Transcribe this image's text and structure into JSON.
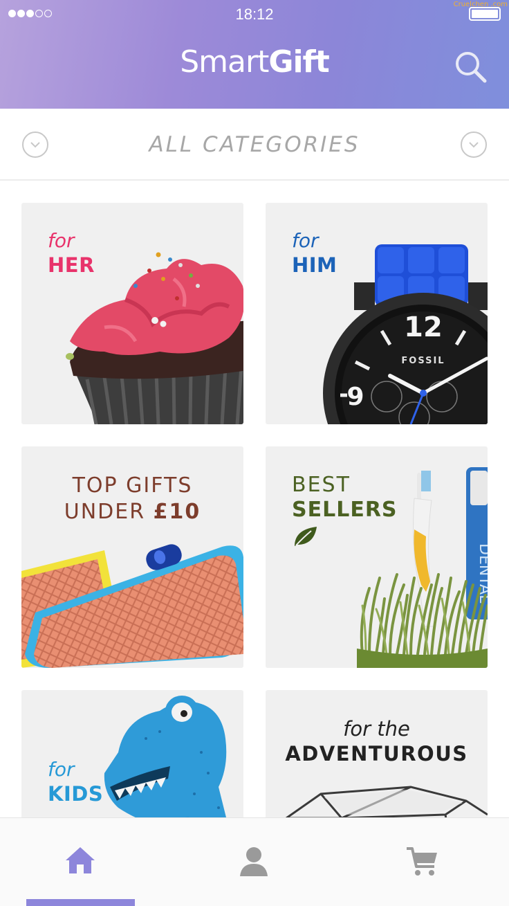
{
  "status": {
    "time": "18:12",
    "watermark": "Cruelchen .com"
  },
  "header": {
    "brand_light": "Smart",
    "brand_bold": "Gift",
    "search_icon": "search-icon"
  },
  "category": {
    "title": "ALL CATEGORIES",
    "prev_icon": "chevron-down-icon",
    "next_icon": "chevron-down-icon"
  },
  "tiles": [
    {
      "id": "her",
      "for_word": "for",
      "big_word": "HER",
      "color": "#e8336b"
    },
    {
      "id": "him",
      "for_word": "for",
      "big_word": "HIM",
      "color": "#1c63b8",
      "watch_brand": "FOSSIL",
      "watch_number": "12"
    },
    {
      "id": "top",
      "line1": "TOP GIFTS",
      "line2_light": "UNDER ",
      "line2_bold": "£10",
      "color": "#7d3d2c"
    },
    {
      "id": "best",
      "line1": "BEST",
      "line2": "SELLERS",
      "color": "#4b6122",
      "leaf_icon": "leaf-icon",
      "paste_label": "DENTAL"
    },
    {
      "id": "kids",
      "for_word": "for",
      "big_word": "KIDS",
      "color": "#2699d6"
    },
    {
      "id": "adv",
      "line1": "for the",
      "line2": "ADVENTUROUS",
      "color": "#222222"
    }
  ],
  "bottom_nav": {
    "items": [
      {
        "name": "home",
        "icon": "home-icon",
        "active": true
      },
      {
        "name": "profile",
        "icon": "user-icon",
        "active": false
      },
      {
        "name": "cart",
        "icon": "cart-icon",
        "active": false
      }
    ],
    "active_color": "#8d86db",
    "inactive_color": "#999999"
  }
}
